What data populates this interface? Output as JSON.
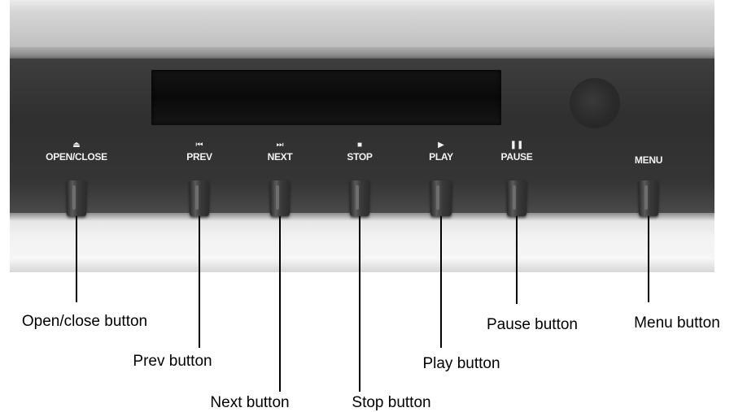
{
  "buttons": {
    "open_close": {
      "glyph": "⏏",
      "label": "OPEN/CLOSE",
      "callout": "Open/close button"
    },
    "prev": {
      "glyph": "⏮",
      "label": "PREV",
      "callout": "Prev button"
    },
    "next": {
      "glyph": "⏭",
      "label": "NEXT",
      "callout": "Next button"
    },
    "stop": {
      "glyph": "■",
      "label": "STOP",
      "callout": "Stop button"
    },
    "play": {
      "glyph": "▶",
      "label": "PLAY",
      "callout": "Play button"
    },
    "pause": {
      "glyph": "❚❚",
      "label": "PAUSE",
      "callout": "Pause button"
    },
    "menu": {
      "label": "MENU",
      "callout": "Menu button"
    }
  }
}
